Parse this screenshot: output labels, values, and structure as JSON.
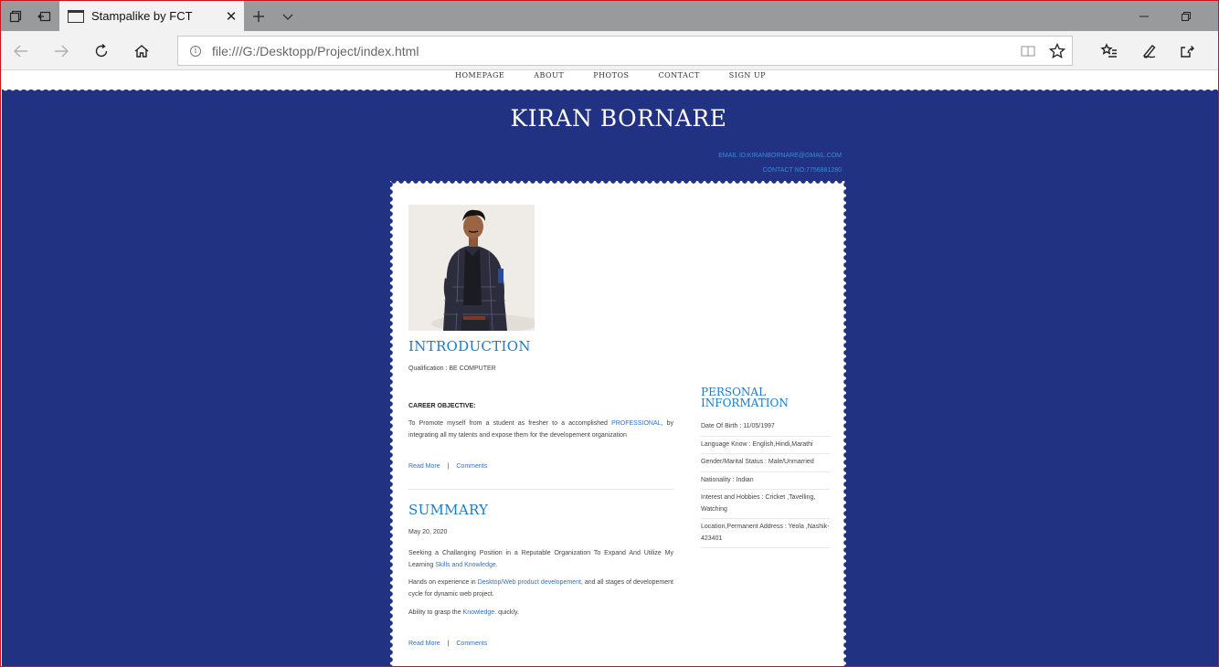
{
  "browser": {
    "tab_title": "Stampalike by FCT",
    "tab_close": "✕",
    "new_tab": "+",
    "url": "file:///G:/Desktopp/Project/index.html",
    "info_icon": "i"
  },
  "site": {
    "nav": [
      "HOMEPAGE",
      "ABOUT",
      "PHOTOS",
      "CONTACT",
      "SIGN UP"
    ],
    "title": "KIRAN BORNARE",
    "email": "EMAIL ID:KIRANBORNARE@GMAIL.COM",
    "contact": "CONTACT NO:7756881280",
    "colors": {
      "background": "#223282",
      "accent": "#1e7bc6",
      "link": "#2f72c6"
    }
  },
  "intro": {
    "heading": "INTRODUCTION",
    "qualification": "Qualification : BE COMPUTER",
    "career_label": "CAREER OBJECTIVE:",
    "career_text_1": "To Promote myself from a student as fresher to a accomplished ",
    "career_link": "PROFESSIONAL",
    "career_text_2": ", by integrating all my talents and expose them for the developement organization",
    "read_more": "Read More",
    "separator": "|",
    "comments": "Comments"
  },
  "summary": {
    "heading": "SUMMARY",
    "date": "May 20, 2020",
    "p1_text": "Seeking a Challanging Position in a Reputable Organization To Expand And Utilize My Learning ",
    "p1_link": "Skills and Knowledge.",
    "p2_text_1": "Hands on experience in ",
    "p2_link": "Desktop/Web product developement,",
    "p2_text_2": " and all stages of developement cycle for dynamic web project.",
    "p3_text_1": "Ability to grasp the ",
    "p3_link": "Knowledge.",
    "p3_text_2": " quickly.",
    "read_more": "Read More",
    "separator": "|",
    "comments": "Comments"
  },
  "personal": {
    "heading": "PERSONAL INFORMATION",
    "items": [
      "Date Of Birth : 11/05/1997",
      "Language Know : English,Hindi,Marathi",
      "Gender/Marital Status : Male/Unmarried",
      "Nationality : Indian",
      "Interest and Hobbies : Cricket ,Tavelling, Watching",
      "Location,Permanent Address : Yeola ,Nashik-423401"
    ]
  }
}
